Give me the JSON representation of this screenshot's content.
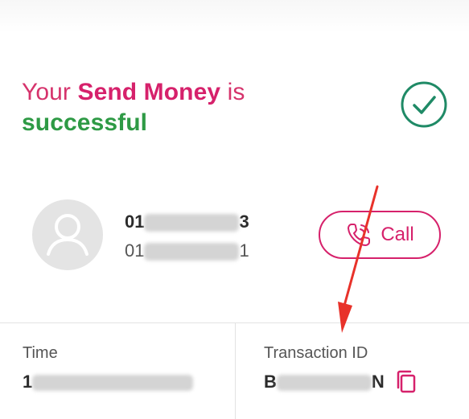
{
  "status": {
    "prefix": "Your ",
    "service": "Send Money",
    "middle": " is",
    "result": "successful",
    "check_icon": "check-circle-icon"
  },
  "contact": {
    "avatar_icon": "user-avatar-icon",
    "name_visible": "01",
    "name_tail": "3",
    "number_visible": "01",
    "number_tail": "1"
  },
  "call": {
    "label": "Call",
    "icon": "phone-icon"
  },
  "time": {
    "label": "Time",
    "value_visible": "1"
  },
  "transaction": {
    "label": "Transaction ID",
    "value_head": "B",
    "value_tail": "N",
    "copy_icon": "copy-icon"
  },
  "colors": {
    "brand": "#d6216b",
    "success": "#2e9a45",
    "annotation": "#e8322a"
  }
}
